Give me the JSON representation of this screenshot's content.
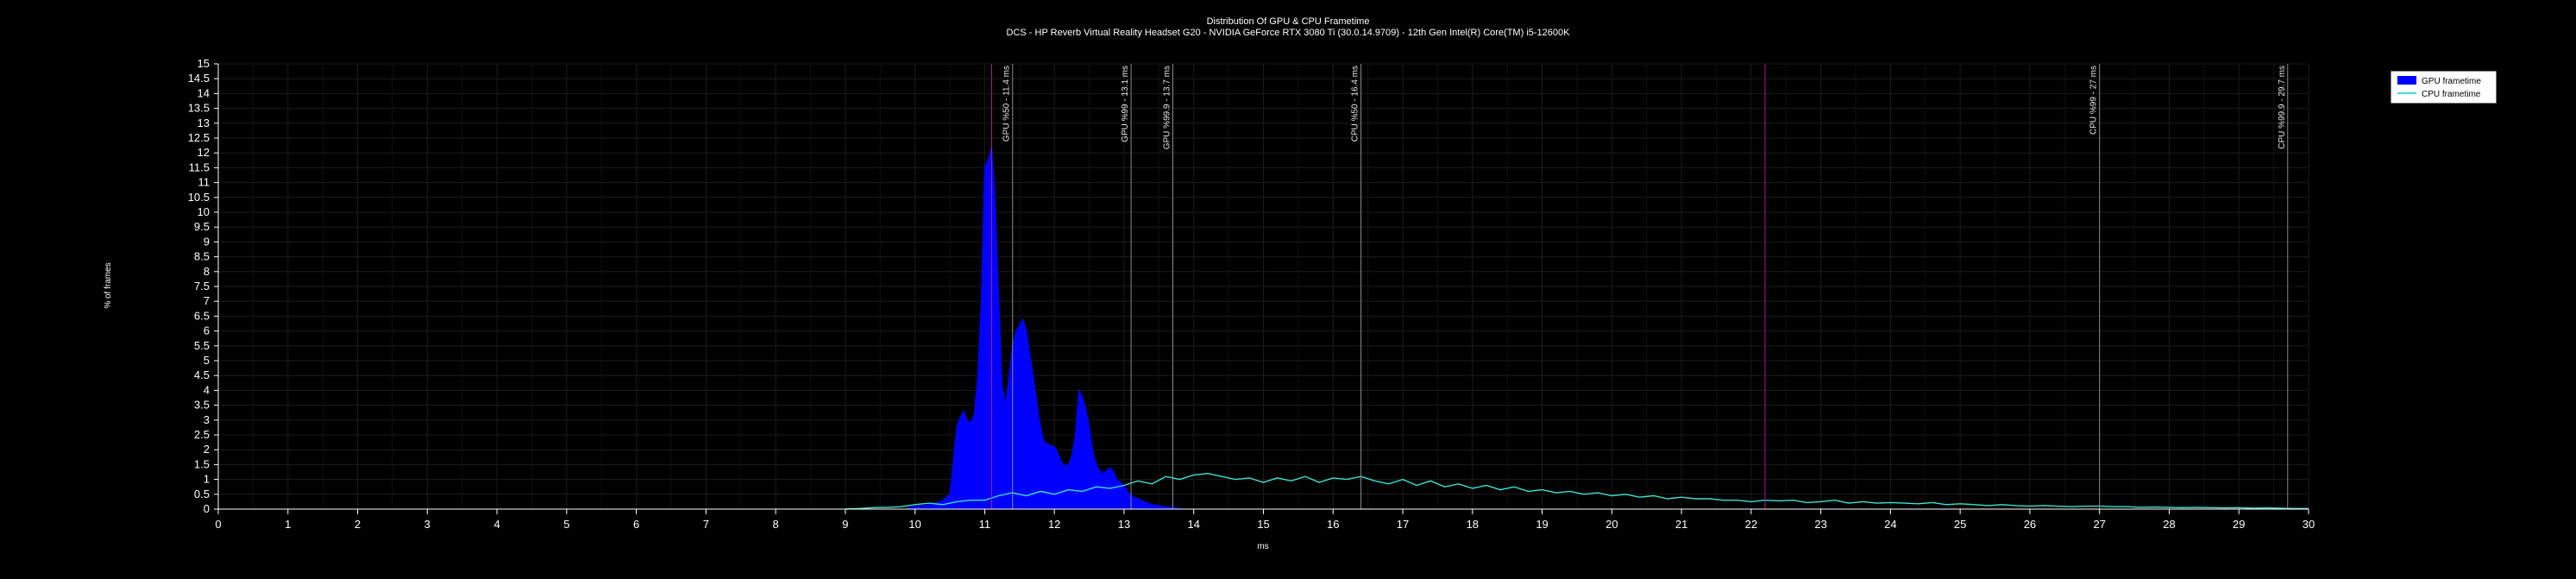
{
  "chart_data": {
    "type": "area",
    "title": "Distribution Of GPU & CPU Frametime",
    "subtitle": "DCS - HP Reverb Virtual Reality Headset G20 - NVIDIA GeForce RTX 3080 Ti (30.0.14.9709) - 12th Gen Intel(R) Core(TM) i5-12600K",
    "xlabel": "ms",
    "ylabel": "% of frames",
    "xlim": [
      0,
      30
    ],
    "ylim": [
      0,
      15
    ],
    "x_ticks": [
      "0",
      "1",
      "2",
      "3",
      "4",
      "5",
      "6",
      "7",
      "8",
      "9",
      "10",
      "11",
      "12",
      "13",
      "14",
      "15",
      "16",
      "17",
      "18",
      "19",
      "20",
      "21",
      "22",
      "23",
      "24",
      "25",
      "26",
      "27",
      "28",
      "29",
      "30"
    ],
    "y_ticks": [
      "0",
      "0.5",
      "1",
      "1.5",
      "2",
      "2.5",
      "3",
      "3.5",
      "4",
      "4.5",
      "5",
      "5.5",
      "6",
      "6.5",
      "7",
      "7.5",
      "8",
      "8.5",
      "9",
      "9.5",
      "10",
      "10.5",
      "11",
      "11.5",
      "12",
      "12.5",
      "13",
      "13.5",
      "14",
      "14.5",
      "15"
    ],
    "grid": true,
    "legend_position": "top-right",
    "colors": {
      "gpu": "#0000ff",
      "cpu": "#40e0d0",
      "background": "#000000",
      "grid": "#1c1c1c",
      "marker": "#8a8a8a",
      "marker_accent": "#a0208a"
    },
    "series": [
      {
        "name": "GPU frametime",
        "style": "area",
        "x": [
          9.9,
          10.0,
          10.1,
          10.2,
          10.3,
          10.4,
          10.5,
          10.6,
          10.65,
          10.7,
          10.75,
          10.8,
          10.85,
          10.9,
          10.95,
          11.0,
          11.05,
          11.1,
          11.15,
          11.2,
          11.25,
          11.3,
          11.35,
          11.4,
          11.45,
          11.5,
          11.55,
          11.6,
          11.65,
          11.7,
          11.75,
          11.8,
          11.85,
          11.9,
          11.95,
          12.0,
          12.05,
          12.1,
          12.15,
          12.2,
          12.25,
          12.3,
          12.35,
          12.4,
          12.45,
          12.5,
          12.55,
          12.6,
          12.65,
          12.7,
          12.75,
          12.8,
          12.85,
          12.9,
          12.95,
          13.0,
          13.05,
          13.1,
          13.2,
          13.3,
          13.4,
          13.5,
          13.6,
          13.7,
          13.8
        ],
        "values": [
          0.05,
          0.1,
          0.12,
          0.15,
          0.2,
          0.3,
          0.5,
          2.8,
          3.1,
          3.3,
          3.0,
          2.9,
          3.2,
          4.5,
          7.0,
          11.5,
          11.8,
          12.2,
          10.5,
          7.2,
          4.2,
          3.5,
          4.5,
          5.5,
          6.0,
          6.2,
          6.4,
          6.0,
          5.2,
          4.4,
          3.6,
          2.8,
          2.3,
          2.2,
          2.15,
          2.1,
          1.9,
          1.6,
          1.45,
          1.5,
          1.8,
          2.5,
          4.0,
          3.8,
          3.4,
          2.8,
          2.0,
          1.5,
          1.3,
          1.2,
          1.3,
          1.4,
          1.25,
          1.0,
          0.9,
          0.8,
          0.6,
          0.45,
          0.35,
          0.25,
          0.15,
          0.12,
          0.08,
          0.05,
          0.02
        ]
      },
      {
        "name": "CPU frametime",
        "style": "line",
        "x": [
          9.0,
          9.2,
          9.4,
          9.6,
          9.8,
          10.0,
          10.2,
          10.4,
          10.6,
          10.8,
          11.0,
          11.2,
          11.4,
          11.6,
          11.8,
          12.0,
          12.2,
          12.4,
          12.6,
          12.8,
          13.0,
          13.2,
          13.4,
          13.6,
          13.8,
          14.0,
          14.2,
          14.4,
          14.6,
          14.8,
          15.0,
          15.2,
          15.4,
          15.6,
          15.8,
          16.0,
          16.2,
          16.4,
          16.6,
          16.8,
          17.0,
          17.2,
          17.4,
          17.6,
          17.8,
          18.0,
          18.2,
          18.4,
          18.6,
          18.8,
          19.0,
          19.2,
          19.4,
          19.6,
          19.8,
          20.0,
          20.2,
          20.4,
          20.6,
          20.8,
          21.0,
          21.2,
          21.4,
          21.6,
          21.8,
          22.0,
          22.2,
          22.4,
          22.6,
          22.8,
          23.0,
          23.2,
          23.4,
          23.6,
          23.8,
          24.0,
          24.2,
          24.4,
          24.6,
          24.8,
          25.0,
          25.2,
          25.4,
          25.6,
          25.8,
          26.0,
          26.2,
          26.4,
          26.6,
          26.8,
          27.0,
          27.2,
          27.4,
          27.6,
          27.8,
          28.0,
          28.2,
          28.4,
          28.6,
          28.8,
          29.0,
          29.2,
          29.4,
          29.6,
          29.8,
          30.0
        ],
        "values": [
          0.0,
          0.02,
          0.05,
          0.06,
          0.08,
          0.15,
          0.2,
          0.15,
          0.25,
          0.3,
          0.3,
          0.45,
          0.55,
          0.45,
          0.6,
          0.5,
          0.65,
          0.6,
          0.75,
          0.7,
          0.8,
          0.95,
          0.85,
          1.1,
          1.0,
          1.15,
          1.2,
          1.1,
          1.0,
          1.05,
          0.9,
          1.05,
          0.95,
          1.1,
          0.9,
          1.05,
          1.0,
          1.1,
          0.95,
          0.85,
          1.0,
          0.8,
          0.95,
          0.75,
          0.85,
          0.7,
          0.8,
          0.65,
          0.75,
          0.6,
          0.65,
          0.55,
          0.6,
          0.5,
          0.55,
          0.45,
          0.5,
          0.4,
          0.45,
          0.35,
          0.4,
          0.35,
          0.35,
          0.3,
          0.3,
          0.25,
          0.3,
          0.28,
          0.3,
          0.22,
          0.25,
          0.3,
          0.2,
          0.25,
          0.2,
          0.22,
          0.2,
          0.18,
          0.22,
          0.15,
          0.18,
          0.15,
          0.12,
          0.15,
          0.12,
          0.1,
          0.12,
          0.1,
          0.08,
          0.1,
          0.1,
          0.08,
          0.08,
          0.06,
          0.07,
          0.06,
          0.05,
          0.06,
          0.05,
          0.04,
          0.05,
          0.03,
          0.04,
          0.03,
          0.02,
          0.02
        ]
      }
    ],
    "markers": [
      {
        "x": 11.4,
        "label": "GPU %50 - 11.4 ms",
        "accent": false
      },
      {
        "x": 13.1,
        "label": "GPU %99 - 13.1 ms",
        "accent": false
      },
      {
        "x": 13.7,
        "label": "GPU %99.9 - 13.7 ms",
        "accent": false
      },
      {
        "x": 16.4,
        "label": "CPU %50 - 16.4 ms",
        "accent": false
      },
      {
        "x": 27.0,
        "label": "CPU %99 - 27 ms",
        "accent": false
      },
      {
        "x": 29.7,
        "label": "CPU %99.9 - 29.7 ms",
        "accent": false
      },
      {
        "x": 11.1,
        "label": "",
        "accent": true
      },
      {
        "x": 22.2,
        "label": "",
        "accent": true
      }
    ]
  }
}
